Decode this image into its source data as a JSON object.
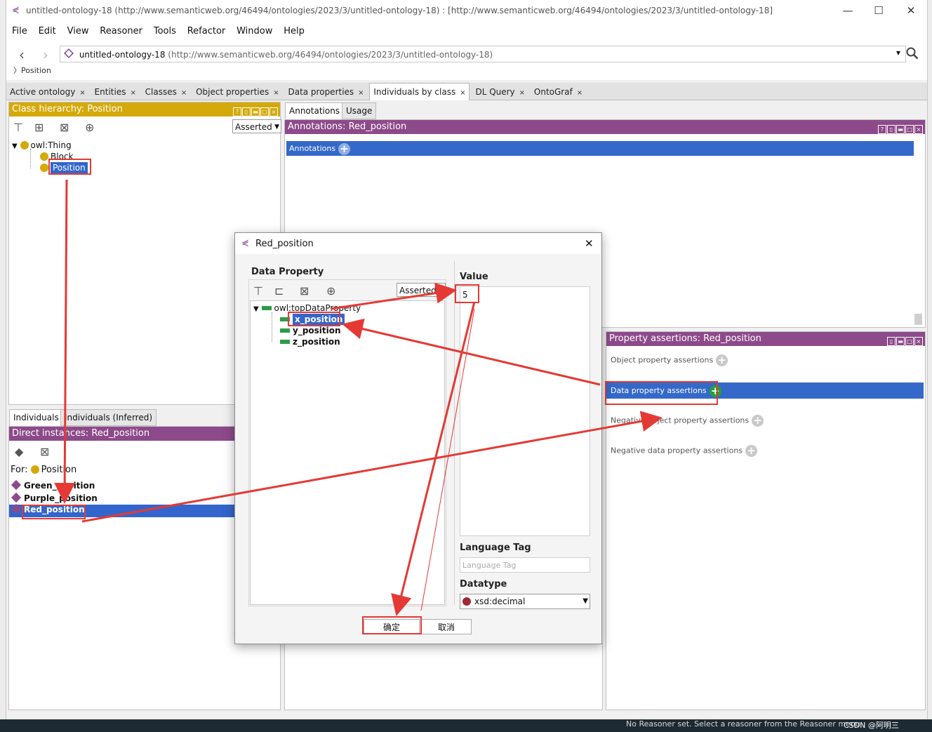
{
  "window": {
    "title": "untitled-ontology-18 (http://www.semanticweb.org/46494/ontologies/2023/3/untitled-ontology-18)  : [http://www.semanticweb.org/46494/ontologies/2023/3/untitled-ontology-18]",
    "minimize": "—",
    "maximize": "☐",
    "close": "✕"
  },
  "menu": [
    "File",
    "Edit",
    "View",
    "Reasoner",
    "Tools",
    "Refactor",
    "Window",
    "Help"
  ],
  "nav": {
    "back": "‹",
    "forward": "›",
    "ontology_name": "untitled-ontology-18",
    "ontology_iri": "(http://www.semanticweb.org/46494/ontologies/2023/3/untitled-ontology-18)",
    "breadcrumb": "Position",
    "dropdown": "▾",
    "search_icon": "search-icon"
  },
  "tabs": [
    {
      "label": "Active ontology",
      "close": "×"
    },
    {
      "label": "Entities",
      "close": "×"
    },
    {
      "label": "Classes",
      "close": "×"
    },
    {
      "label": "Object properties",
      "close": "×"
    },
    {
      "label": "Data properties",
      "close": "×"
    },
    {
      "label": "Individuals by class",
      "close": "×"
    },
    {
      "label": "DL Query",
      "close": "×"
    },
    {
      "label": "OntoGraf",
      "close": "×"
    }
  ],
  "class_hierarchy": {
    "header": "Class hierarchy: Position",
    "mode": "Asserted",
    "tree": [
      "owl:Thing",
      "Block",
      "Position"
    ]
  },
  "annotations_panel": {
    "tabs": [
      "Annotations",
      "Usage"
    ],
    "header": "Annotations: Red_position",
    "bar_label": "Annotations"
  },
  "individuals": {
    "tabs": [
      "Individuals",
      "Individuals (Inferred)"
    ],
    "header": "Direct instances: Red_position",
    "for_label": "For:",
    "for_value": "Position",
    "items": [
      "Green_position",
      "Purple_position",
      "Red_position"
    ]
  },
  "property_assertions": {
    "header": "Property assertions: Red_position",
    "rows": [
      "Object property assertions",
      "Data property assertions",
      "Negative object property assertions",
      "Negative data property assertions"
    ]
  },
  "dialog": {
    "title": "Red_position",
    "close": "✕",
    "data_property_label": "Data Property",
    "mode": "Asserted",
    "tree": [
      "owl:topDataProperty",
      "x_position",
      "y_position",
      "z_position"
    ],
    "value_label": "Value",
    "value": "5",
    "language_tag_label": "Language Tag",
    "language_tag_placeholder": "Language Tag",
    "datatype_label": "Datatype",
    "datatype_value": "xsd:decimal",
    "ok": "确定",
    "cancel": "取消"
  },
  "status_bar": {
    "text": "No Reasoner set. Select a reasoner from the Reasoner menu",
    "watermark": "CSDN @阿明三"
  },
  "colors": {
    "class_header": "#d4a909",
    "individual_header": "#8d4a8a",
    "selection": "#3366cc",
    "annotation_arrow": "#e53935"
  }
}
